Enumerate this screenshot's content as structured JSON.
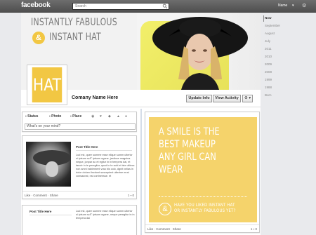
{
  "topbar": {
    "logo": "facebook",
    "search_placeholder": "Search",
    "user": "Name",
    "caret": "▾"
  },
  "cover": {
    "line1": "INSTANTLY FABULOUS",
    "amp": "&",
    "line2": "INSTANT HAT"
  },
  "profile": {
    "pic_text": "HAT",
    "name": "Comany Name Here",
    "update_info": "Update Info",
    "view_activity": "View Activity",
    "gear": "⚙ ▾"
  },
  "composer": {
    "tabs": [
      "Status",
      "Photo",
      "Place"
    ],
    "input_placeholder": "What's on your mind?"
  },
  "posts": [
    {
      "title": "Post Title Here",
      "body": "Lud est, quee summe esse elique summ ultericr si iptsum sciT iptsum egone, jestioce magnina neque, jonpar ac et egitur in in tempera dai, et tanotr in te peregitur, quod in te scid et iste ultima: non amni habiement vrao bis colo, dgnit velias in dolor dolum tincdunt suscepient ultertne mrai consaunat, nsi contnensse. et",
      "footer": "Like · Comment · Share",
      "counts": "1 ▪ 0"
    },
    {
      "title": "Post Title Here",
      "body": "Lud est, quee summe esse elique summ ultericr si iptsum sciT iptsum egone, neque peregitur in in tempera dai"
    },
    {
      "headline": "A SMILE IS THE BEST MAKEUP ANY GIRL CAN WEAR",
      "headline_lines": [
        "A SMILE IS THE",
        "BEST MAKEUP",
        "ANY GIRL CAN",
        "WEAR"
      ],
      "amp": "&",
      "question_lines": [
        "HAVE YOU LIKED INSTANT HAT",
        "OR INSTANTLY FABULOUS YET?"
      ],
      "footer": "Like · Comment · Share",
      "counts": "1 ▪ 0"
    }
  ],
  "right_nav": [
    "Now",
    "September",
    "August",
    "July",
    "2011",
    "2010",
    "2009",
    "2008",
    "1999",
    "1988",
    "Born"
  ],
  "colors": {
    "brand_yellow": "#f2c743",
    "topbar": "#5a5a5a",
    "page_bg": "#e9eaed"
  }
}
